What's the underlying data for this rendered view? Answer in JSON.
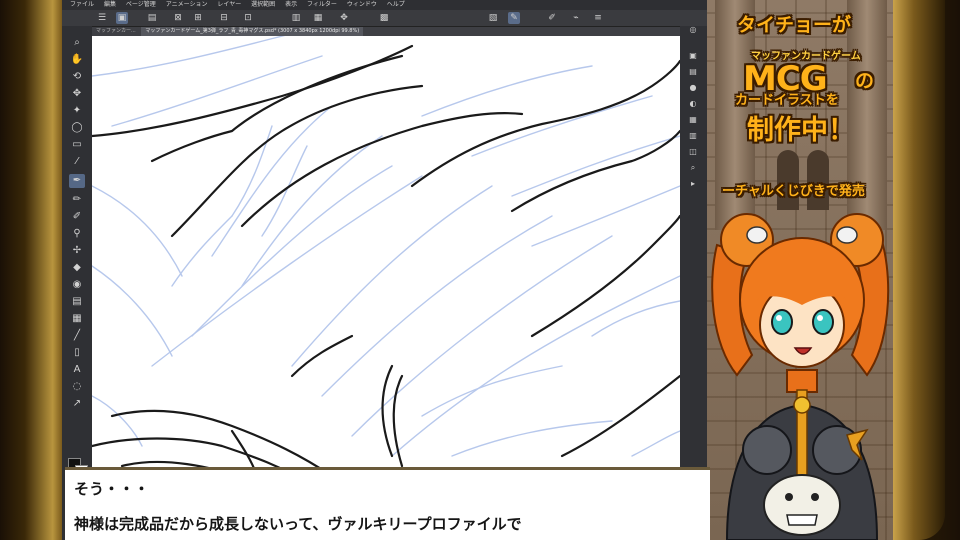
{
  "menu": [
    "ファイル",
    "編集",
    "ページ管理",
    "アニメーション",
    "レイヤー",
    "選択範囲",
    "表示",
    "フィルター",
    "ウィンドウ",
    "ヘルプ"
  ],
  "tabs": [
    "マッファンカー...",
    "マッファンカードゲーム_第3弾_ラフ_青_毒神マグス.psd* (3007 x 3840px 1200dpi 99.8%)"
  ],
  "toolbar_icons": [
    "menu-icon",
    "new-icon",
    "open-icon",
    "save-icon",
    "undo-icon",
    "redo-icon",
    "settings-icon",
    "fill-icon",
    "transform-icon",
    "move-icon",
    "grid-icon",
    "brush-icon",
    "edit-icon",
    "link-icon",
    "layers-icon"
  ],
  "tools_left": [
    "zoom-icon",
    "hand-icon",
    "rotate-icon",
    "move-icon",
    "select-icon",
    "lasso-icon",
    "rect-select-icon",
    "eyedropper-icon",
    "pen-icon",
    "pencil-icon",
    "brush-icon",
    "airbrush-icon",
    "blend-icon",
    "eraser-icon",
    "fill-icon",
    "gradient-icon",
    "ruler-icon",
    "figure-icon",
    "text-icon",
    "balloon-icon",
    "correct-icon"
  ],
  "tools_right": [
    "navigator-icon",
    "subview-icon",
    "properties-icon",
    "brush-size-icon",
    "color-icon",
    "layer-icon",
    "history-icon",
    "material-icon",
    "search-icon",
    "auto-action-icon",
    "info-icon",
    "timeline-icon"
  ],
  "panel": {
    "title_line1": "タイチョーが",
    "title_small": "マッファンカードゲーム",
    "title_big": "MCG",
    "title_no": "の",
    "title_line3": "カードイラストを",
    "title_line4": "制作中！",
    "promo": "ーチャルくじびきで発売"
  },
  "subtitle": {
    "line1": "そう・・・",
    "line2": "神様は完成品だから成長しないって、ヴァルキリープロファイルで"
  },
  "colors": {
    "accent": "#ffb21a",
    "outline": "#3b1d00",
    "menu_bg": "#2e2f33",
    "canvas_bg": "#ffffff",
    "hair": "#e8701a"
  }
}
